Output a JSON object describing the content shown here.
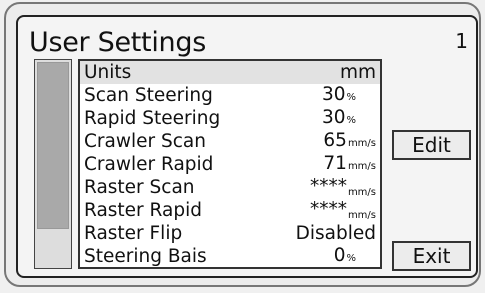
{
  "header": {
    "title": "User Settings",
    "page_number": "1"
  },
  "settings": [
    {
      "label": "Units",
      "value": "mm",
      "unit": ""
    },
    {
      "label": "Scan Steering",
      "value": "30",
      "unit": "%"
    },
    {
      "label": "Rapid Steering",
      "value": "30",
      "unit": "%"
    },
    {
      "label": "Crawler Scan",
      "value": "65",
      "unit": "mm/s"
    },
    {
      "label": "Crawler Rapid",
      "value": "71",
      "unit": "mm/s"
    },
    {
      "label": "Raster Scan",
      "value": "****",
      "unit": "mm/s"
    },
    {
      "label": "Raster Rapid",
      "value": "****",
      "unit": "mm/s"
    },
    {
      "label": "Raster Flip",
      "value": "Disabled",
      "unit": ""
    },
    {
      "label": "Steering Bais",
      "value": "0",
      "unit": "%"
    }
  ],
  "buttons": {
    "edit_label": "Edit",
    "exit_label": "Exit"
  },
  "scrollbar": {
    "position_fraction": 0.0,
    "visible_fraction": 0.82
  }
}
